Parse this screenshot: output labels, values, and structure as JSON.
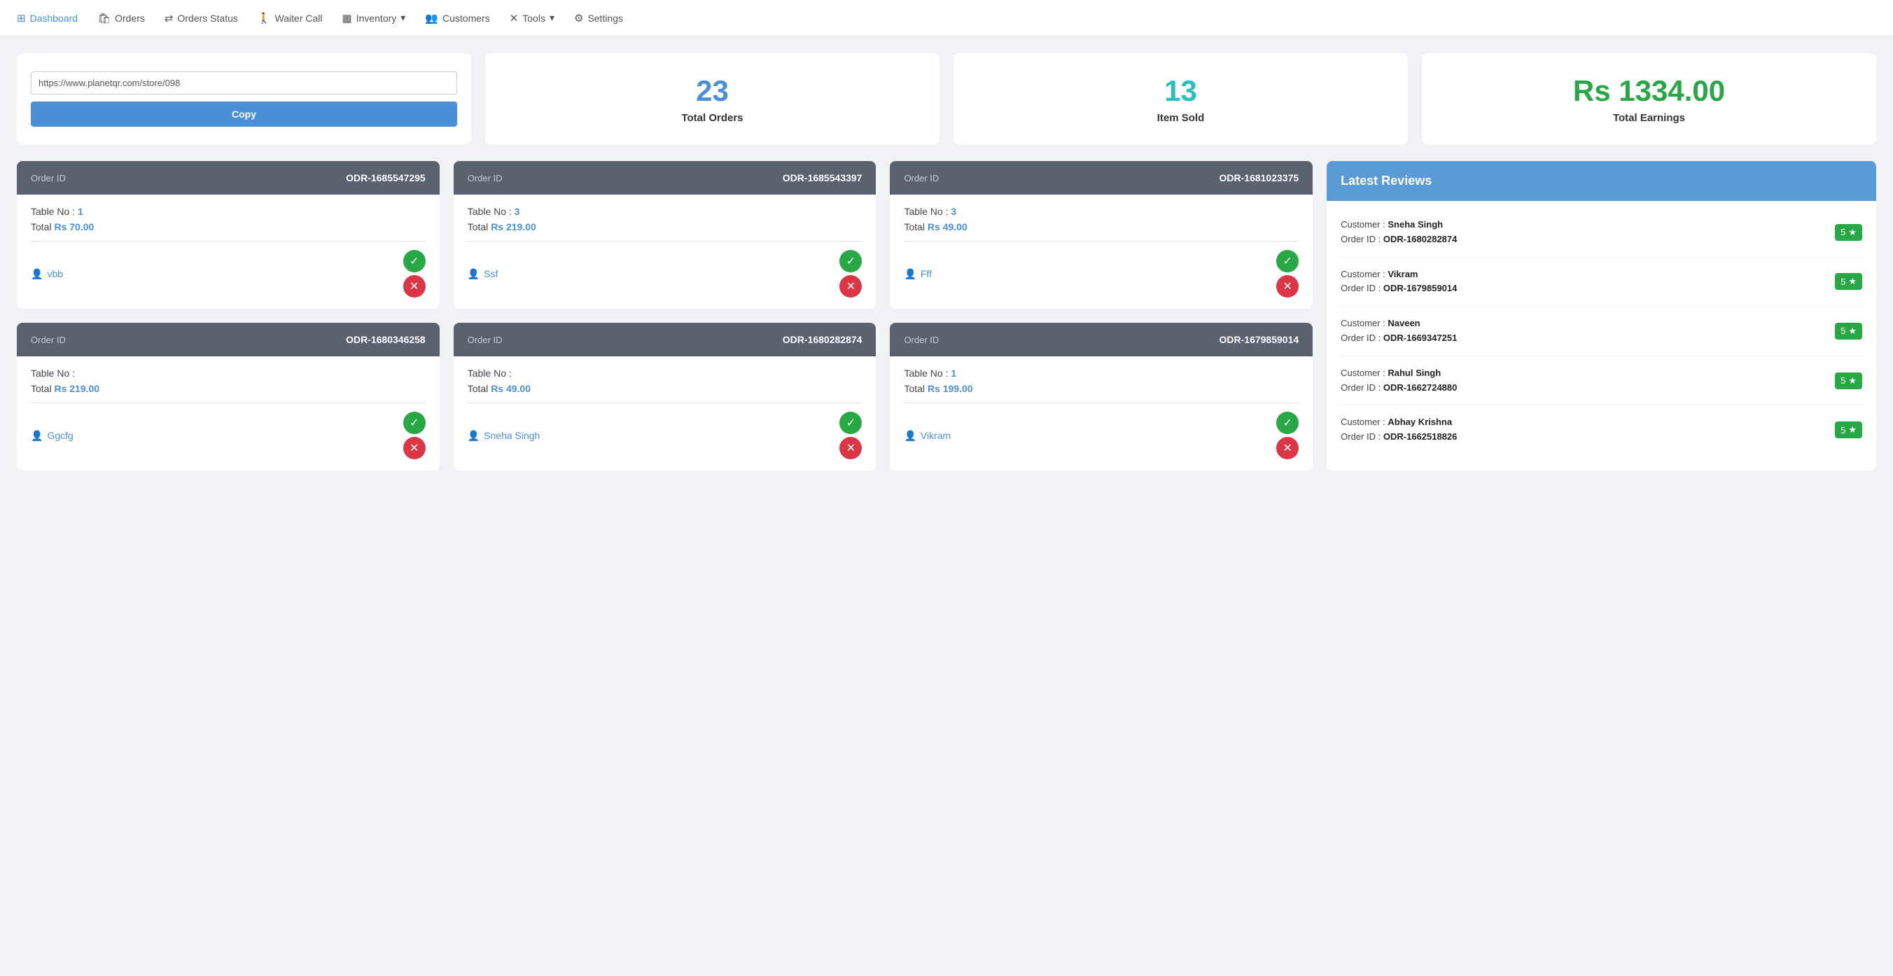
{
  "nav": {
    "items": [
      {
        "id": "dashboard",
        "label": "Dashboard",
        "icon": "⊞",
        "active": true
      },
      {
        "id": "orders",
        "label": "Orders",
        "icon": "🛍"
      },
      {
        "id": "orders-status",
        "label": "Orders Status",
        "icon": "↔"
      },
      {
        "id": "waiter-call",
        "label": "Waiter Call",
        "icon": "🚶"
      },
      {
        "id": "inventory",
        "label": "Inventory",
        "icon": "▦",
        "hasDropdown": true
      },
      {
        "id": "customers",
        "label": "Customers",
        "icon": "👥"
      },
      {
        "id": "tools",
        "label": "Tools",
        "icon": "✕",
        "hasDropdown": true
      },
      {
        "id": "settings",
        "label": "Settings",
        "icon": "⚙"
      }
    ]
  },
  "stats": {
    "url": {
      "value": "https://www.planetqr.com/store/098",
      "copy_label": "Copy"
    },
    "total_orders": {
      "number": "23",
      "label": "Total Orders"
    },
    "item_sold": {
      "number": "13",
      "label": "Item Sold"
    },
    "total_earnings": {
      "number": "Rs 1334.00",
      "label": "Total Earnings"
    }
  },
  "orders": [
    {
      "id": "order-1",
      "order_id_label": "Order ID",
      "order_id_value": "ODR-1685547295",
      "table_label": "Table No :",
      "table_value": "1",
      "total_label": "Total",
      "total_value": "Rs 70.00",
      "customer": "vbb"
    },
    {
      "id": "order-2",
      "order_id_label": "Order ID",
      "order_id_value": "ODR-1685543397",
      "table_label": "Table No :",
      "table_value": "3",
      "total_label": "Total",
      "total_value": "Rs 219.00",
      "customer": "Ssf"
    },
    {
      "id": "order-3",
      "order_id_label": "Order ID",
      "order_id_value": "ODR-1681023375",
      "table_label": "Table No :",
      "table_value": "3",
      "total_label": "Total",
      "total_value": "Rs 49.00",
      "customer": "Fff"
    },
    {
      "id": "order-4",
      "order_id_label": "Order ID",
      "order_id_value": "ODR-1680346258",
      "table_label": "Table No :",
      "table_value": "",
      "total_label": "Total",
      "total_value": "Rs 219.00",
      "customer": "Ggcfg"
    },
    {
      "id": "order-5",
      "order_id_label": "Order ID",
      "order_id_value": "ODR-1680282874",
      "table_label": "Table No :",
      "table_value": "",
      "total_label": "Total",
      "total_value": "Rs 49.00",
      "customer": "Sneha Singh"
    },
    {
      "id": "order-6",
      "order_id_label": "Order ID",
      "order_id_value": "ODR-1679859014",
      "table_label": "Table No :",
      "table_value": "1",
      "total_label": "Total",
      "total_value": "Rs 199.00",
      "customer": "Vikram"
    }
  ],
  "reviews": {
    "title": "Latest Reviews",
    "items": [
      {
        "customer_label": "Customer :",
        "customer_name": "Sneha Singh",
        "order_label": "Order ID :",
        "order_id": "ODR-1680282874",
        "stars": "5"
      },
      {
        "customer_label": "Customer :",
        "customer_name": "Vikram",
        "order_label": "Order ID :",
        "order_id": "ODR-1679859014",
        "stars": "5"
      },
      {
        "customer_label": "Customer :",
        "customer_name": "Naveen",
        "order_label": "Order ID :",
        "order_id": "ODR-1669347251",
        "stars": "5"
      },
      {
        "customer_label": "Customer :",
        "customer_name": "Rahul Singh",
        "order_label": "Order ID :",
        "order_id": "ODR-1662724880",
        "stars": "5"
      },
      {
        "customer_label": "Customer :",
        "customer_name": "Abhay Krishna",
        "order_label": "Order ID :",
        "order_id": "ODR-1662518826",
        "stars": "5"
      }
    ]
  }
}
